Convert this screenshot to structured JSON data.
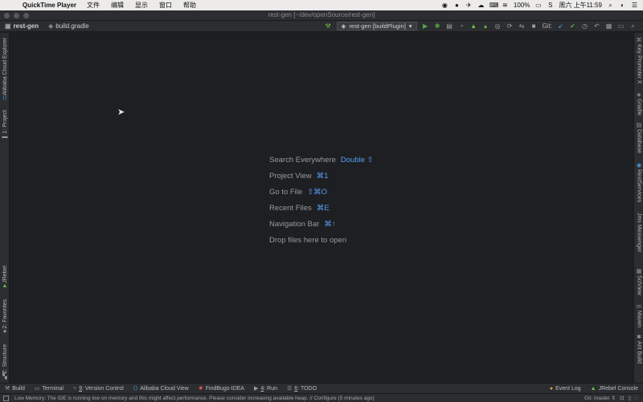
{
  "menubar": {
    "app_name": "QuickTime Player",
    "items": [
      "文件",
      "编辑",
      "显示",
      "窗口",
      "帮助"
    ],
    "battery": "100%",
    "datetime": "周六 上午11:59"
  },
  "window": {
    "title": "rest-gen [~/dev/openSource/rest-gen]"
  },
  "navbar": {
    "crumbs": [
      "rest-gen",
      "build.gradle"
    ],
    "run_config": "rest-gen [buildPlugin]",
    "git_label": "Git:"
  },
  "left_tabs": [
    "Alibaba Cloud Explorer",
    "1: Project",
    "JRebel",
    "2: Favorites",
    "Z: Structure"
  ],
  "right_tabs": [
    "Key Promoter X",
    "Gradle",
    "Database",
    "RestServices",
    "Jms Messenger",
    "SciView",
    "Maven",
    "Ant Build"
  ],
  "hints": [
    {
      "label": "Search Everywhere",
      "key": "Double ⇧"
    },
    {
      "label": "Project View",
      "key": "⌘1"
    },
    {
      "label": "Go to File",
      "key": "⇧⌘O"
    },
    {
      "label": "Recent Files",
      "key": "⌘E"
    },
    {
      "label": "Navigation Bar",
      "key": "⌘↑"
    },
    {
      "label": "Drop files here to open",
      "key": ""
    }
  ],
  "bottom_tabs": [
    {
      "num": "",
      "label": "Build"
    },
    {
      "num": "",
      "label": "Terminal"
    },
    {
      "num": "9",
      "label": ": Version Control"
    },
    {
      "num": "",
      "label": "Alibaba Cloud View"
    },
    {
      "num": "",
      "label": "FindBugs-IDEA"
    },
    {
      "num": "4",
      "label": ": Run"
    },
    {
      "num": "6",
      "label": ": TODO"
    }
  ],
  "bottom_right": {
    "event_log": "Event Log",
    "jrebel_console": "JRebel Console"
  },
  "status": {
    "message": "Low Memory: The IDE is running low on memory and this might affect performance. Please consider increasing available heap. // Configure (5 minutes ago)",
    "git_branch": "Git: master ⇕"
  },
  "colors": {
    "background": "#1e1f22",
    "chrome": "#2b2d30",
    "accent": "#589df6"
  }
}
